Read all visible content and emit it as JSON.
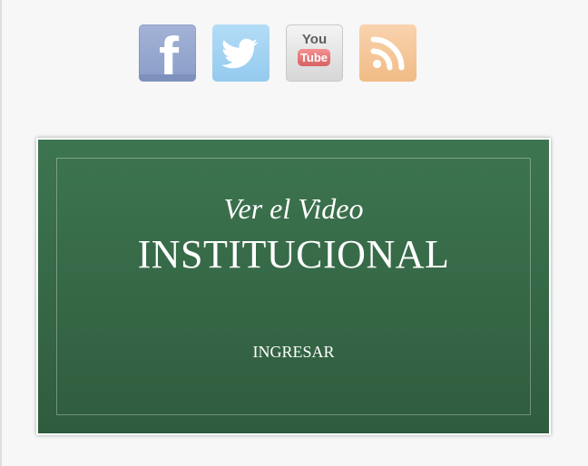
{
  "social": {
    "facebook_icon": "facebook-icon",
    "twitter_icon": "twitter-icon",
    "youtube_icon": "youtube-icon",
    "youtube_you": "You",
    "youtube_tube": "Tube",
    "rss_icon": "rss-icon",
    "colors": {
      "facebook": "#8b9dc8",
      "twitter": "#a6d4f2",
      "youtube_red": "#e07272",
      "rss": "#f4c596"
    }
  },
  "video_card": {
    "subtitle": "Ver el Video",
    "title": "INSTITUCIONAL",
    "action": "INGRESAR",
    "background_color": "#356845"
  }
}
